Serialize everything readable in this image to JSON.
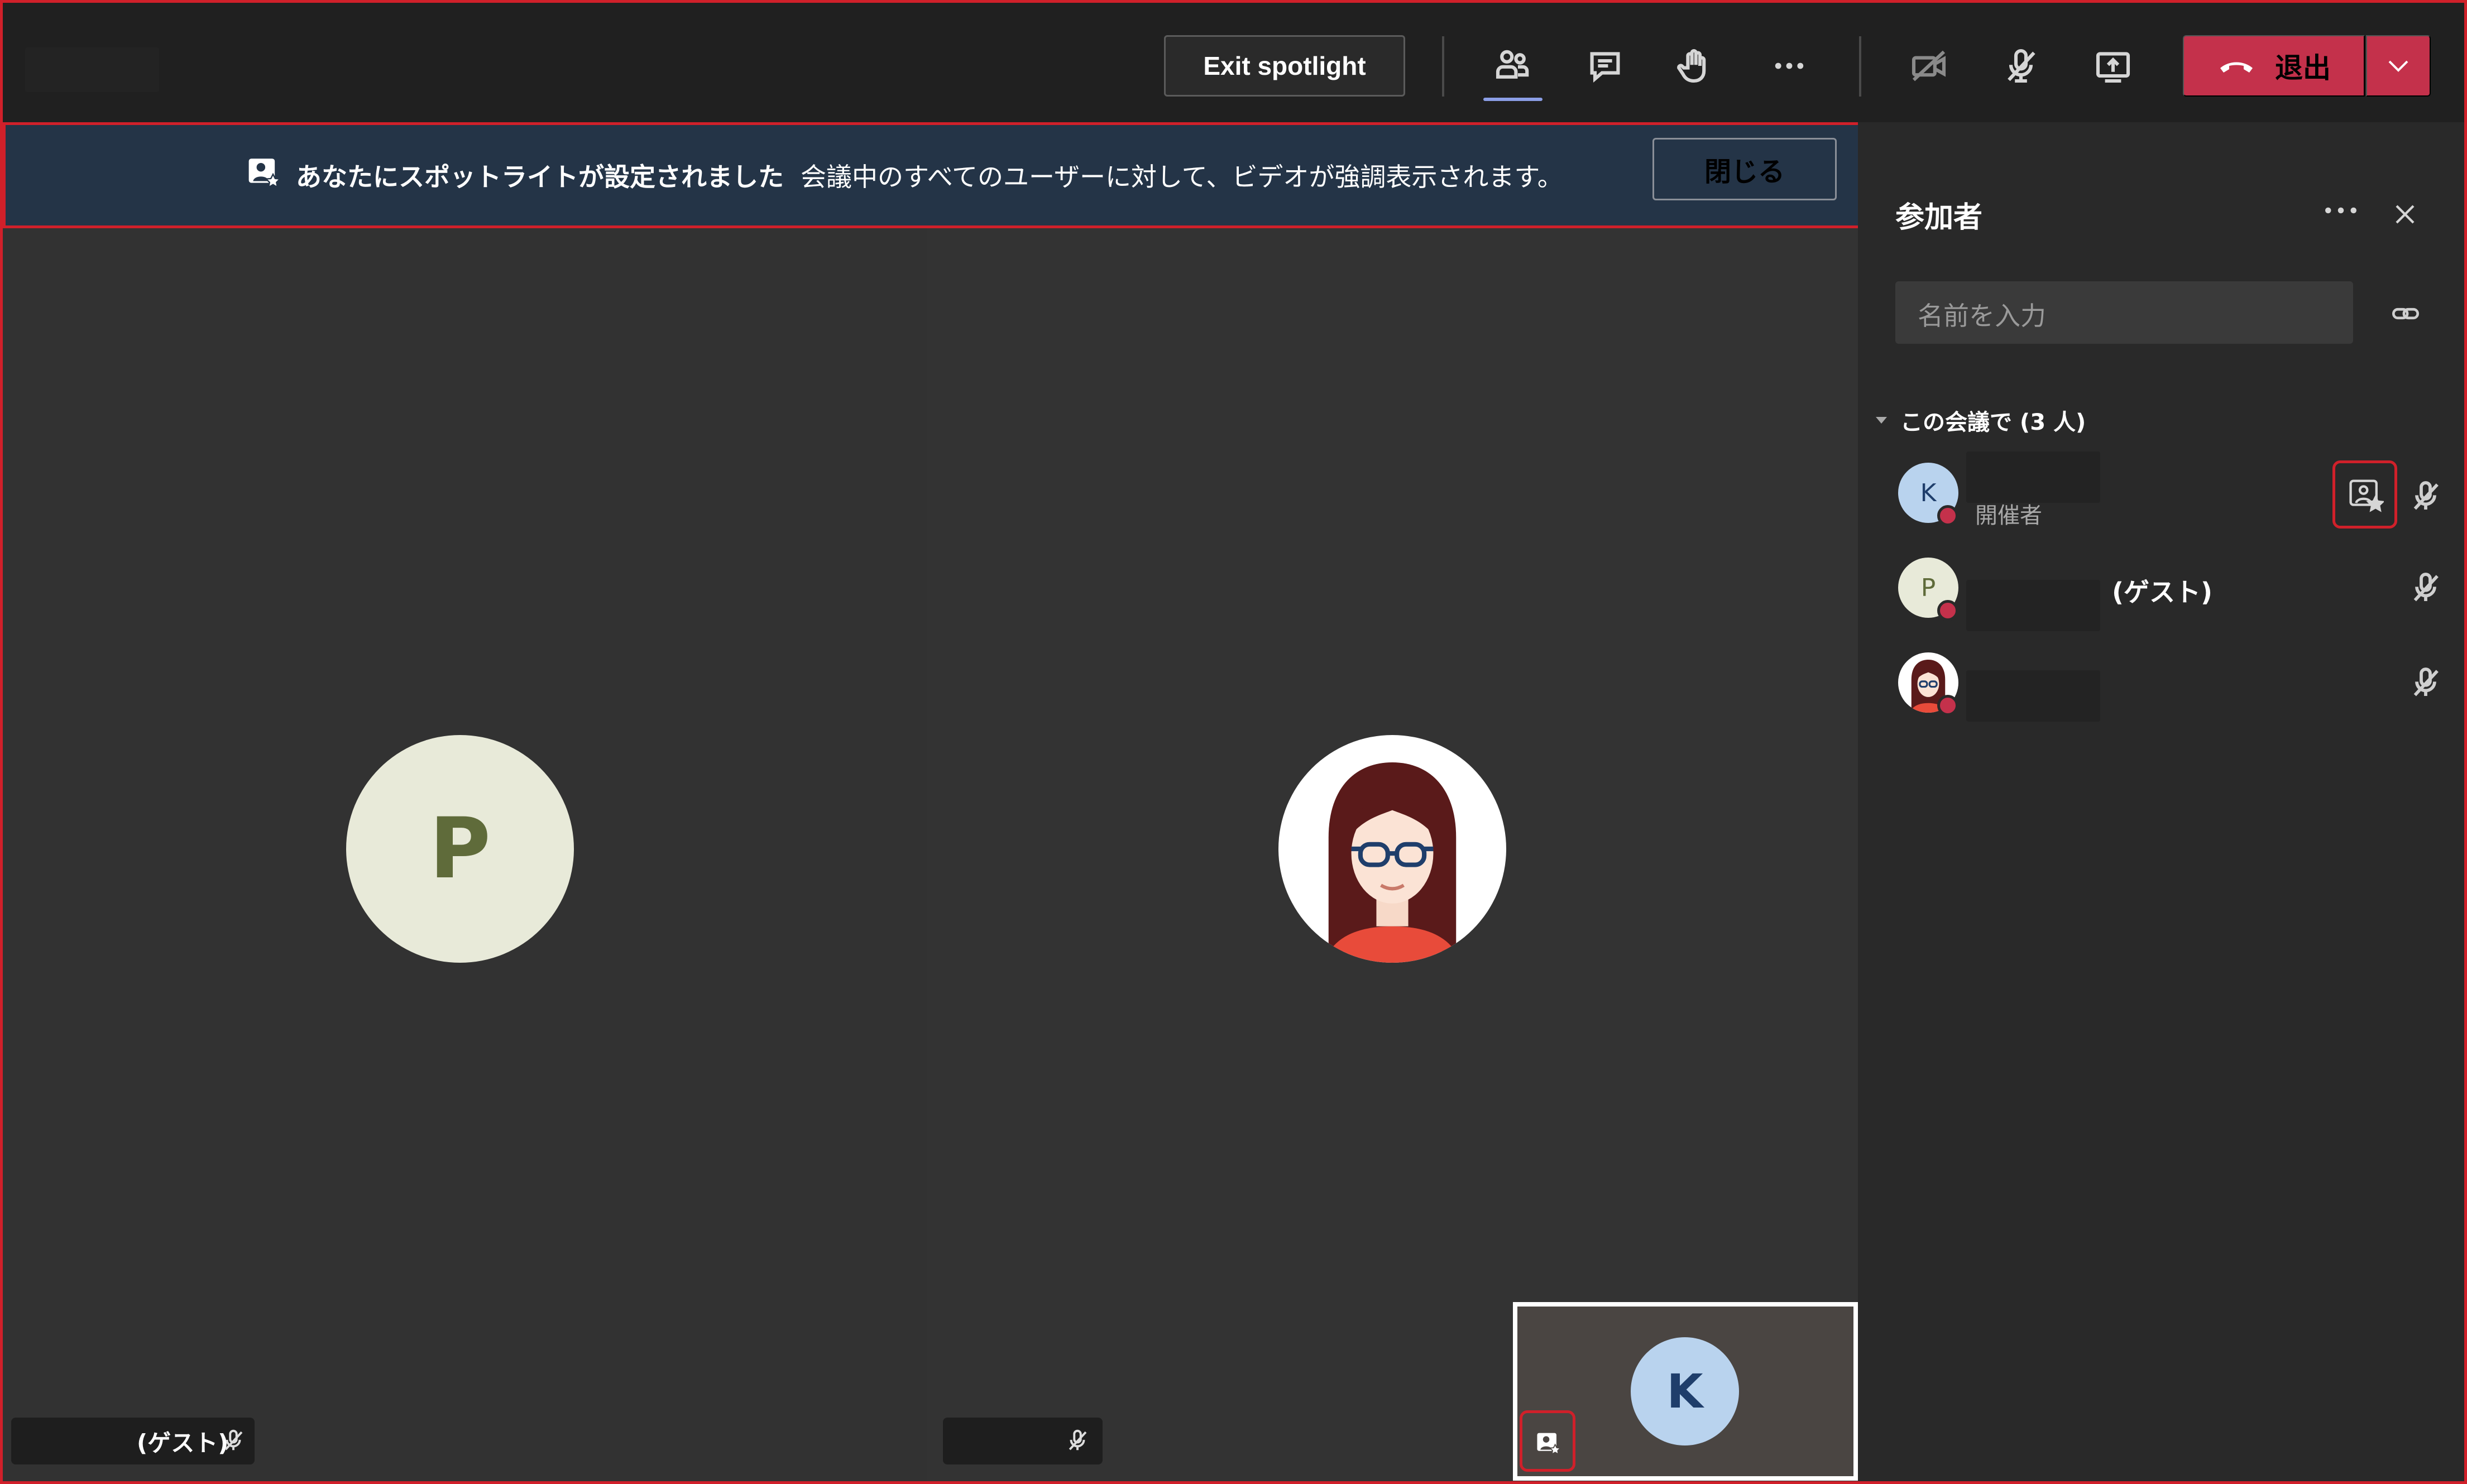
{
  "toolbar": {
    "exit_spotlight_label": "Exit spotlight",
    "leave_label": "退出",
    "icons": [
      "people-icon",
      "chat-icon",
      "raise-hand-icon",
      "more-icon",
      "camera-off-icon",
      "mic-off-icon",
      "share-screen-icon",
      "phone-hangup-icon",
      "chevron-down-icon"
    ]
  },
  "banner": {
    "title": "あなたにスポットライトが設定されました",
    "message": "会議中のすべてのユーザーに対して、ビデオが強調表示されます。",
    "close_label": "閉じる"
  },
  "stage": {
    "left_tile": {
      "initial": "P",
      "name_suffix": "(ゲスト)"
    },
    "right_tile": {
      "avatar": "cartoon-woman-with-glasses"
    },
    "self_view": {
      "initial": "K"
    }
  },
  "participants_panel": {
    "title": "参加者",
    "search_placeholder": "名前を入力",
    "section_label": "この会議で (3 人)",
    "participants": [
      {
        "initial": "K",
        "role": "開催者",
        "spotlight": true
      },
      {
        "initial": "P",
        "suffix": "(ゲスト)"
      },
      {
        "avatar": "cartoon-woman-with-glasses"
      }
    ]
  },
  "colors": {
    "accent_red": "#c4314b",
    "banner_bg": "#243447",
    "p_avatar_bg": "#e8ead9",
    "k_avatar_bg": "#b9d3ee",
    "highlight_box": "#d0202a"
  }
}
